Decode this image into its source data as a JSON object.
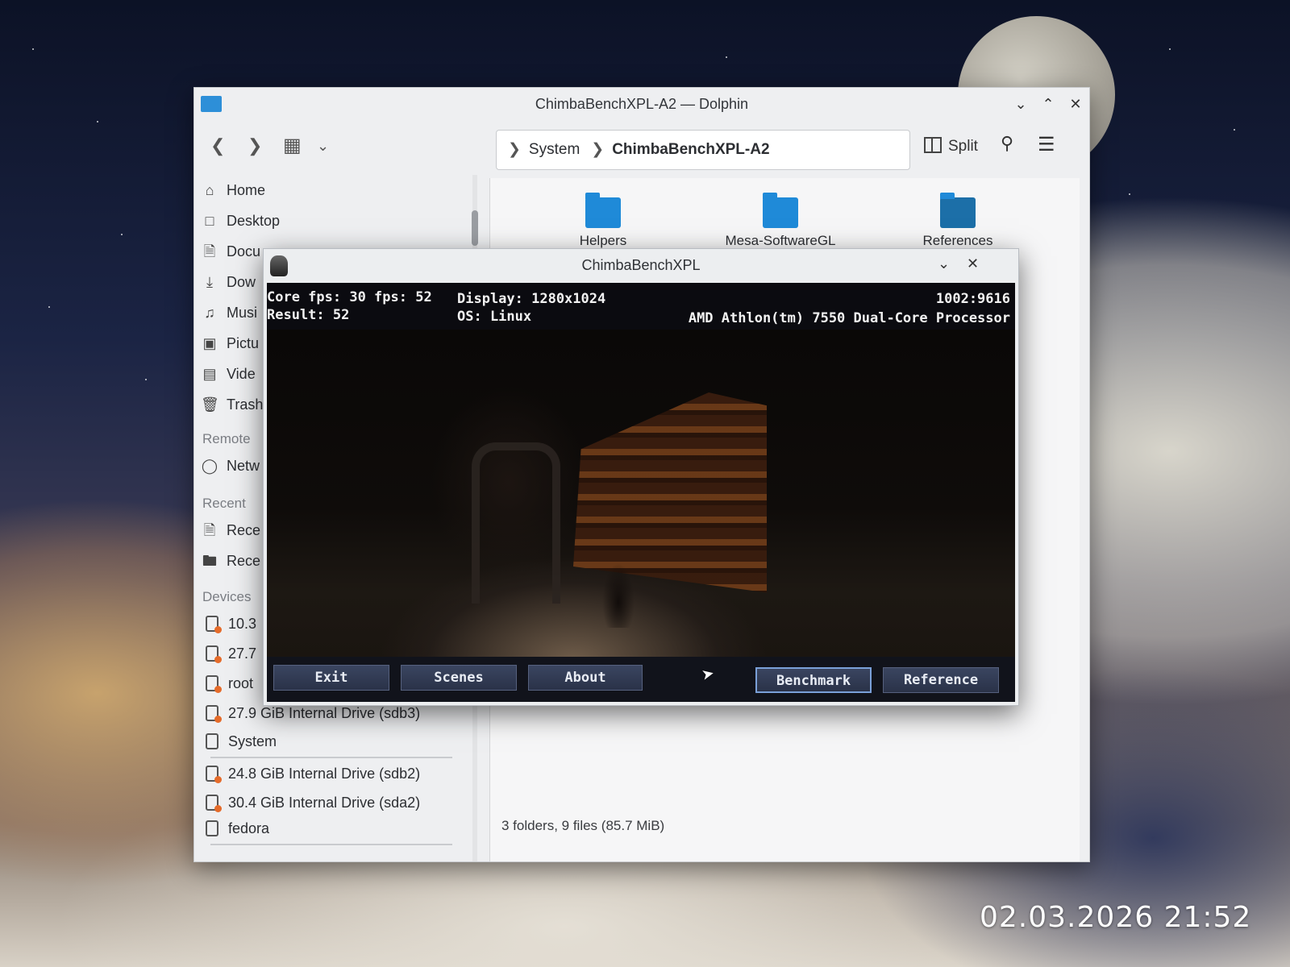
{
  "desktop": {
    "timestamp": "02.03.2026 21:52"
  },
  "dolphin": {
    "title": "ChimbaBenchXPL-A2 — Dolphin",
    "icons": {
      "back": "back-icon",
      "forward": "forward-icon",
      "view": "view-mode-icon",
      "split": "split-icon",
      "search": "search-icon",
      "menu": "hamburger-menu-icon"
    },
    "breadcrumb": {
      "parent": "System",
      "current": "ChimbaBenchXPL-A2"
    },
    "split_label": "Split",
    "sidebar": {
      "places": [
        {
          "label": "Home",
          "icon": "home-icon"
        },
        {
          "label": "Desktop",
          "icon": "desktop-icon"
        },
        {
          "label": "Docu",
          "icon": "documents-icon"
        },
        {
          "label": "Dow",
          "icon": "downloads-icon"
        },
        {
          "label": "Musi",
          "icon": "music-icon"
        },
        {
          "label": "Pictu",
          "icon": "pictures-icon"
        },
        {
          "label": "Vide",
          "icon": "videos-icon"
        },
        {
          "label": "Trash",
          "icon": "trash-icon"
        }
      ],
      "remote_heading": "Remote",
      "remote": [
        {
          "label": "Netw",
          "icon": "network-icon"
        }
      ],
      "recent_heading": "Recent",
      "recent": [
        {
          "label": "Rece",
          "icon": "recent-files-icon"
        },
        {
          "label": "Rece",
          "icon": "recent-locations-icon"
        }
      ],
      "devices_heading": "Devices",
      "devices": [
        {
          "label": "10.3"
        },
        {
          "label": "27.7"
        },
        {
          "label": "root"
        },
        {
          "label": "27.9 GiB Internal Drive (sdb3)"
        },
        {
          "label": "System"
        },
        {
          "label": "24.8 GiB Internal Drive (sdb2)"
        },
        {
          "label": "30.4 GiB Internal Drive (sda2)"
        },
        {
          "label": "fedora"
        }
      ]
    },
    "folders": [
      "Helpers",
      "Mesa-SoftwareGL",
      "References"
    ],
    "status": "3 folders, 9 files (85.7 MiB)"
  },
  "bench": {
    "title": "ChimbaBenchXPL",
    "hud": {
      "fps": "Core fps: 30 fps: 52",
      "result": "Result: 52",
      "display": "Display: 1280x1024",
      "os": "OS: Linux",
      "code": "1002:9616",
      "cpu": "AMD Athlon(tm) 7550 Dual-Core Processor"
    },
    "buttons": {
      "exit": "Exit",
      "scenes": "Scenes",
      "about": "About",
      "benchmark": "Benchmark",
      "reference": "Reference"
    }
  }
}
